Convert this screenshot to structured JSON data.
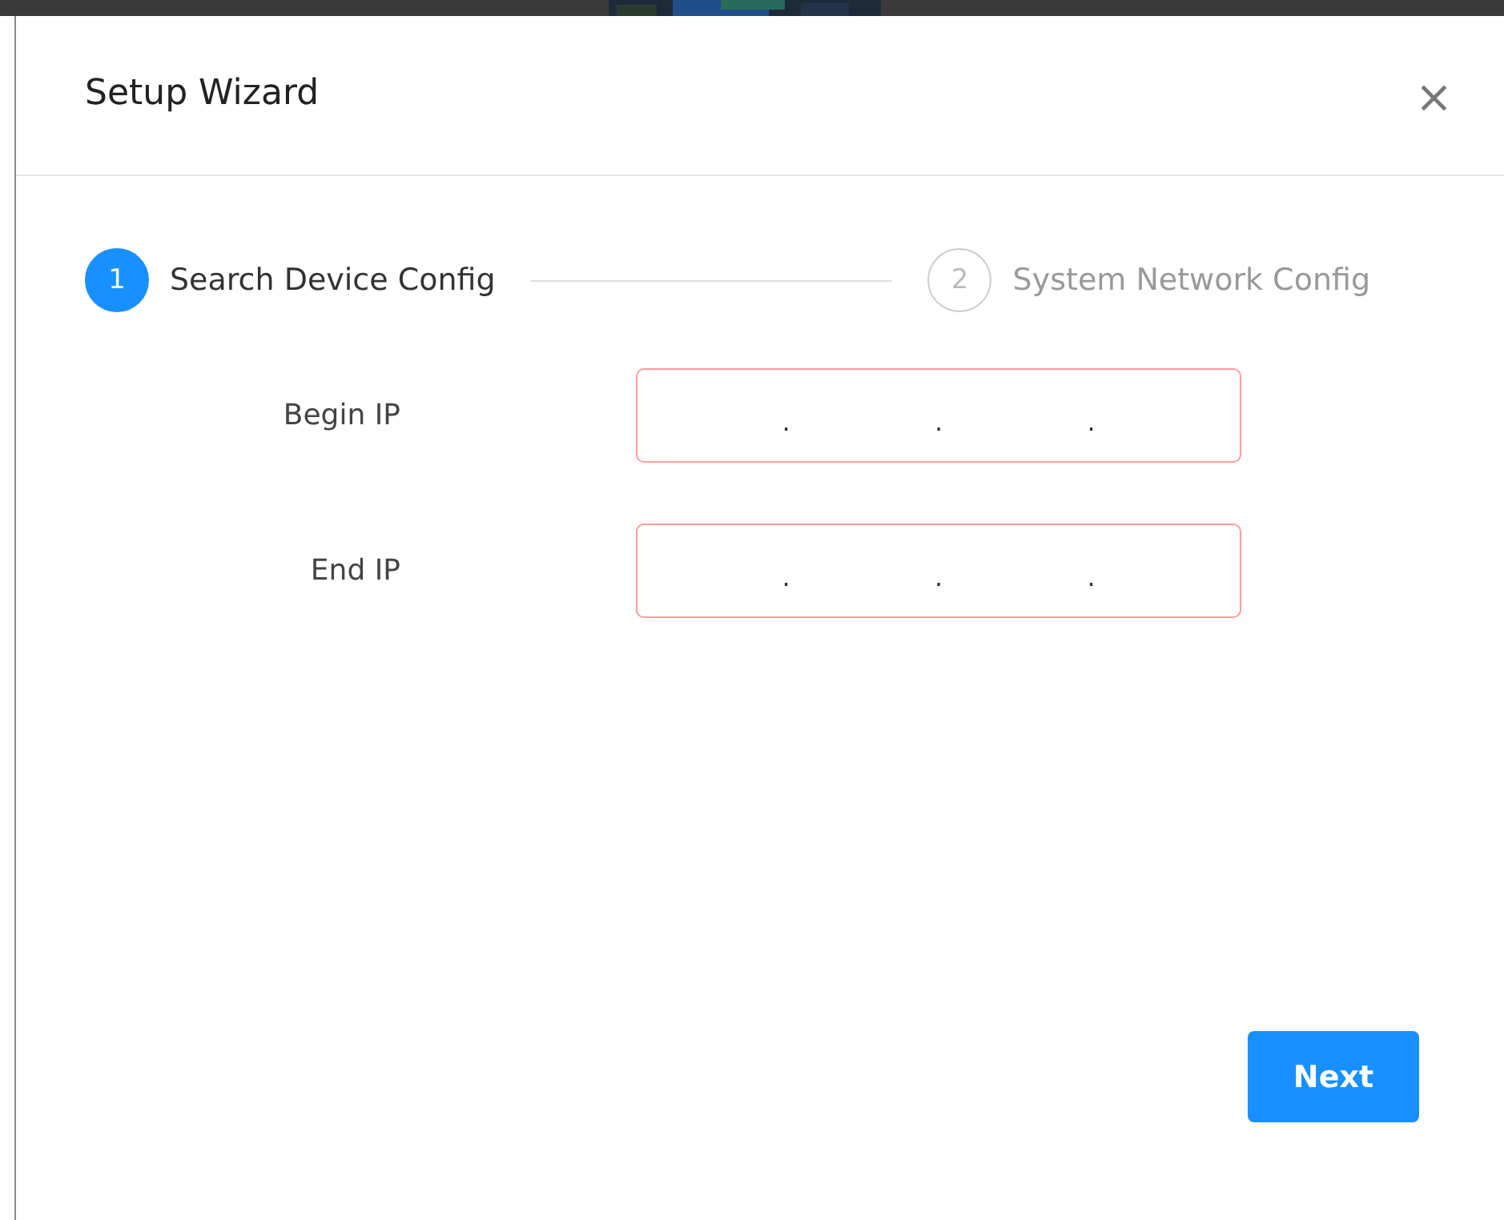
{
  "window": {
    "title": "Setup Wizard",
    "close": "×"
  },
  "steps": [
    {
      "number": "1",
      "label": "Search Device Config",
      "selected": true
    },
    {
      "number": "2",
      "label": "System Network Config",
      "selected": false
    }
  ],
  "fields": [
    {
      "label": "Begin IP",
      "separators": [
        ".",
        ".",
        "."
      ],
      "invalid": true
    },
    {
      "label": "End IP",
      "separators": [
        ".",
        ".",
        "."
      ],
      "invalid": true
    }
  ],
  "buttons": [
    "Next"
  ]
}
